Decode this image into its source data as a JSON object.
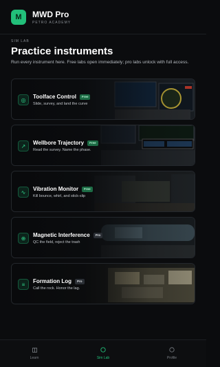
{
  "header": {
    "logo_text": "M",
    "app_title": "MWD Pro",
    "app_subtitle": "PETRO ACADEMY"
  },
  "page": {
    "kicker": "SIM LAB",
    "title": "Practice instruments",
    "description": "Run every instrument here. Free labs open immediately; pro labs unlock with full access."
  },
  "cards": [
    {
      "title": "Toolface Control",
      "badge": "Free",
      "subtitle": "Slide, survey, and land the curve",
      "icon": "target-icon",
      "glyph": "◎"
    },
    {
      "title": "Wellbore Trajectory",
      "badge": "Free",
      "subtitle": "Read the survey. Name the phase.",
      "icon": "trajectory-arrow-icon",
      "glyph": "↗"
    },
    {
      "title": "Vibration Monitor",
      "badge": "Free",
      "subtitle": "Kill bounce, whirl, and stick-slip",
      "icon": "wave-icon",
      "glyph": "∿"
    },
    {
      "title": "Magnetic Interference",
      "badge": "Pro",
      "subtitle": "QC the field, reject the trash",
      "icon": "crosshair-icon",
      "glyph": "⊕"
    },
    {
      "title": "Formation Log",
      "badge": "Pro",
      "subtitle": "Call the rock. Honor the lag.",
      "icon": "log-lines-icon",
      "glyph": "≡"
    }
  ],
  "tabs": [
    {
      "label": "Learn",
      "icon": "book-icon",
      "active": false
    },
    {
      "label": "Sim Lab",
      "icon": "sim-lab-icon",
      "active": true
    },
    {
      "label": "Profile",
      "icon": "profile-icon",
      "active": false
    }
  ],
  "colors": {
    "accent": "#22c07a",
    "background": "#0b0c0e",
    "badge_free": "#1d6b45",
    "badge_pro": "#2b2f35"
  }
}
